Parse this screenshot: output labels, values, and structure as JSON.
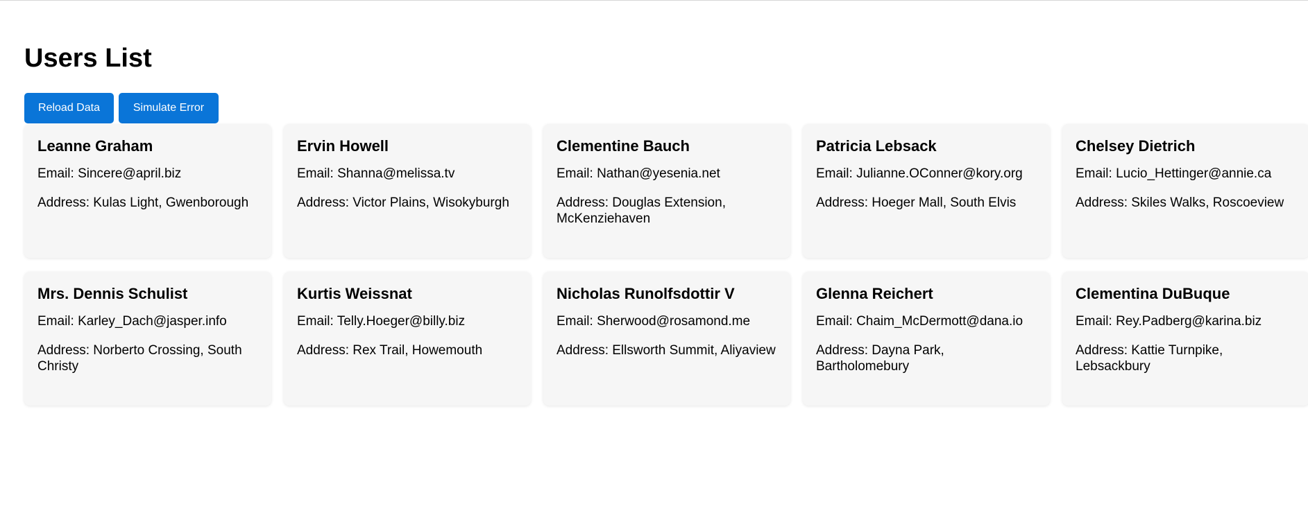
{
  "page": {
    "title": "Users List"
  },
  "toolbar": {
    "reload_label": "Reload Data",
    "error_label": "Simulate Error"
  },
  "theme": {
    "accent": "#0a75d8",
    "card_bg": "#f6f6f6"
  },
  "users": [
    {
      "name": "Leanne Graham",
      "email": "Email: Sincere@april.biz",
      "address": "Address: Kulas Light, Gwenborough"
    },
    {
      "name": "Ervin Howell",
      "email": "Email: Shanna@melissa.tv",
      "address": "Address: Victor Plains, Wisokyburgh"
    },
    {
      "name": "Clementine Bauch",
      "email": "Email: Nathan@yesenia.net",
      "address": "Address: Douglas Extension, McKenziehaven"
    },
    {
      "name": "Patricia Lebsack",
      "email": "Email: Julianne.OConner@kory.org",
      "address": "Address: Hoeger Mall, South Elvis"
    },
    {
      "name": "Chelsey Dietrich",
      "email": "Email: Lucio_Hettinger@annie.ca",
      "address": "Address: Skiles Walks, Roscoeview"
    },
    {
      "name": "Mrs. Dennis Schulist",
      "email": "Email: Karley_Dach@jasper.info",
      "address": "Address: Norberto Crossing, South Christy"
    },
    {
      "name": "Kurtis Weissnat",
      "email": "Email: Telly.Hoeger@billy.biz",
      "address": "Address: Rex Trail, Howemouth"
    },
    {
      "name": "Nicholas Runolfsdottir V",
      "email": "Email: Sherwood@rosamond.me",
      "address": "Address: Ellsworth Summit, Aliyaview"
    },
    {
      "name": "Glenna Reichert",
      "email": "Email: Chaim_McDermott@dana.io",
      "address": "Address: Dayna Park, Bartholomebury"
    },
    {
      "name": "Clementina DuBuque",
      "email": "Email: Rey.Padberg@karina.biz",
      "address": "Address: Kattie Turnpike, Lebsackbury"
    }
  ]
}
